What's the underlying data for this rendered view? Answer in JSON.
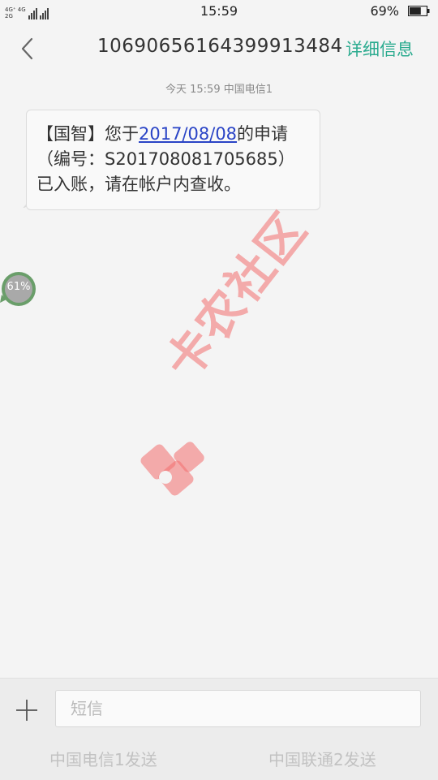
{
  "status_bar": {
    "network_top": "4G⁺ 4G",
    "network_bottom": "2G ",
    "time": "15:59",
    "battery_percent": "69%",
    "battery_level": 0.69
  },
  "header": {
    "back_icon": "chevron-left-icon",
    "title": "10690656164399913484",
    "detail_label": "详细信息",
    "accent_color": "#2bab8f"
  },
  "conversation": {
    "timestamp": "今天  15:59  中国电信1",
    "message": {
      "line1_prefix": "【国智】您于",
      "line1_date": "2017/08/08",
      "line1_suffix": "的申请",
      "line2": "（编号：S201708081705685）",
      "line3": "已入账，请在帐户内查收。"
    }
  },
  "float_ball": {
    "percent": "61%",
    "value": 0.61
  },
  "watermark": {
    "text": "卡农社区",
    "color": "#f26e6e"
  },
  "compose": {
    "attach_icon": "plus-icon",
    "placeholder": "短信",
    "send_sim1": "中国电信1发送",
    "send_sim2": "中国联通2发送"
  }
}
